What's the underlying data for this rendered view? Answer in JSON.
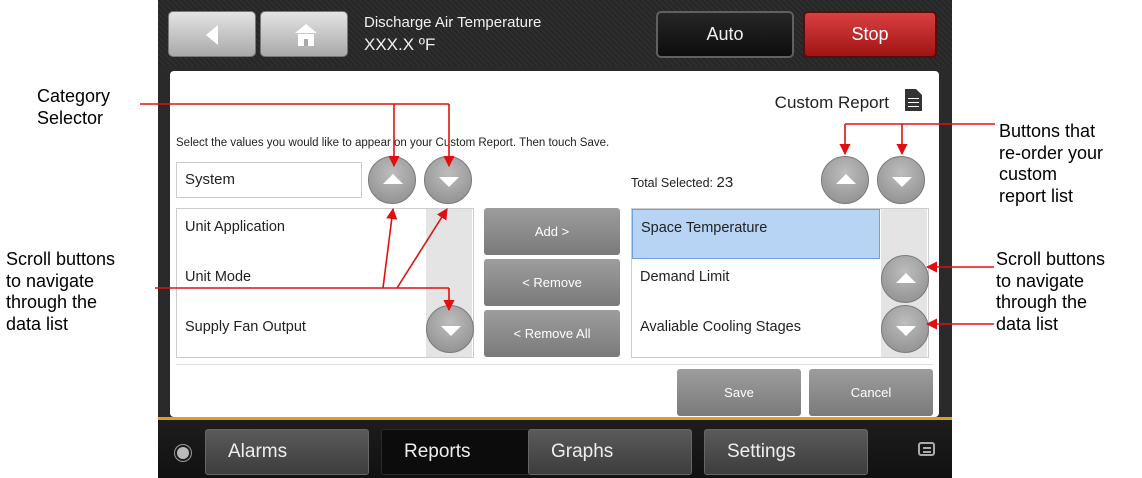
{
  "header": {
    "point_label": "Discharge Air Temperature",
    "point_value": "XXX.X ºF",
    "auto_label": "Auto",
    "stop_label": "Stop"
  },
  "panel": {
    "title": "Custom Report",
    "instructions": "Select the values you would like to appear on your Custom Report. Then touch Save.",
    "category": "System",
    "total_label": "Total Selected:",
    "total_count": "23",
    "available_items": [
      "Unit Application",
      "Unit Mode",
      "Supply Fan Output"
    ],
    "selected_items": [
      "Space Temperature",
      "Demand Limit",
      "Avaliable Cooling Stages"
    ],
    "add_label": "Add >",
    "remove_label": "< Remove",
    "remove_all_label": "< Remove All",
    "save_label": "Save",
    "cancel_label": "Cancel"
  },
  "nav": {
    "alarms": "Alarms",
    "reports": "Reports",
    "graphs": "Graphs",
    "settings": "Settings"
  },
  "annotations": {
    "category_selector": [
      "Category",
      "Selector"
    ],
    "reorder_buttons": [
      "Buttons that",
      "re-order your",
      "custom",
      "report list"
    ],
    "scroll_left": [
      "Scroll buttons",
      "to navigate",
      "through the",
      "data list"
    ],
    "scroll_right": [
      "Scroll buttons",
      "to navigate",
      "through the",
      "data list"
    ]
  },
  "colors": {
    "annotation_line": "#e01010",
    "stop_button": "#c02020",
    "selection_highlight": "#b7d4f5",
    "nav_accent": "#d8a21c"
  }
}
